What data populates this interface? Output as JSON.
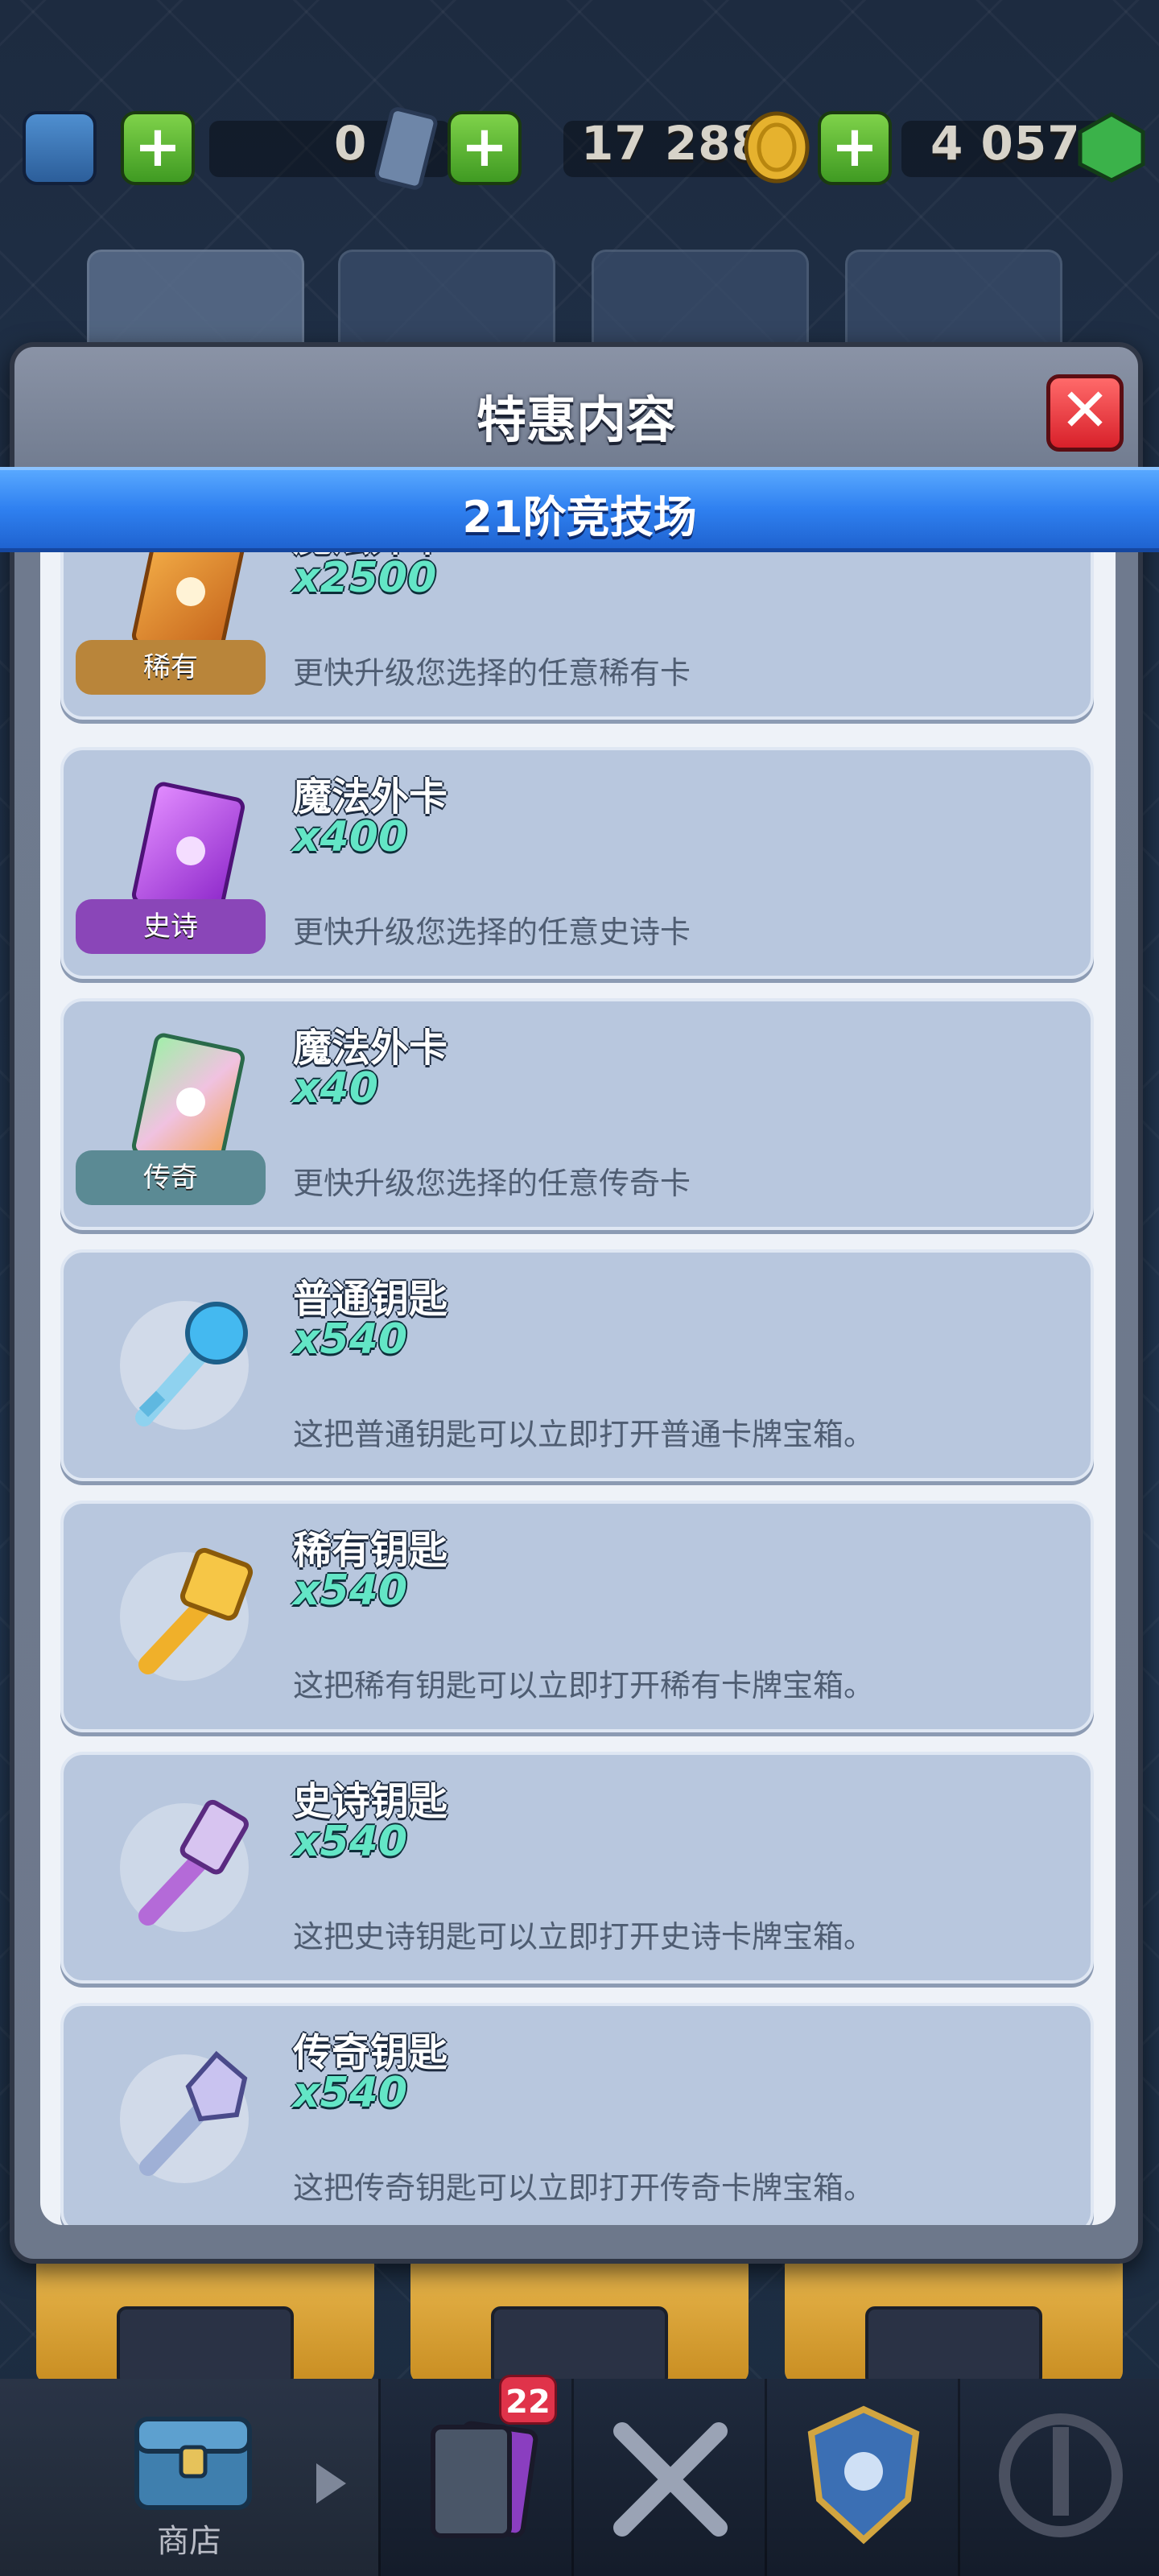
{
  "status_bar": {
    "tickets": "0",
    "gold": "17 288",
    "gems": "4 057"
  },
  "modal": {
    "title": "特惠内容",
    "close_icon": "close-icon",
    "arena_label": "21阶竞技场",
    "items": [
      {
        "name": "魔法外卡",
        "qty": "x2500",
        "desc": "更快升级您选择的任意稀有卡",
        "tag": "稀有",
        "tag_color": "#b9853a",
        "icon": "wild-card-rare-icon",
        "color": "#e38a2a"
      },
      {
        "name": "魔法外卡",
        "qty": "x400",
        "desc": "更快升级您选择的任意史诗卡",
        "tag": "史诗",
        "tag_color": "#8a46b8",
        "icon": "wild-card-epic-icon",
        "color": "#b34ee6"
      },
      {
        "name": "魔法外卡",
        "qty": "x40",
        "desc": "更快升级您选择的任意传奇卡",
        "tag": "传奇",
        "tag_color": "#5b8a94",
        "icon": "wild-card-legendary-icon",
        "color": "#6ad6a8"
      },
      {
        "name": "普通钥匙",
        "qty": "x540",
        "desc": "这把普通钥匙可以立即打开普通卡牌宝箱。",
        "icon": "common-key-icon",
        "color": "#4fc7f0"
      },
      {
        "name": "稀有钥匙",
        "qty": "x540",
        "desc": "这把稀有钥匙可以立即打开稀有卡牌宝箱。",
        "icon": "rare-key-icon",
        "color": "#f2b534"
      },
      {
        "name": "史诗钥匙",
        "qty": "x540",
        "desc": "这把史诗钥匙可以立即打开史诗卡牌宝箱。",
        "icon": "epic-key-icon",
        "color": "#c66ee0"
      },
      {
        "name": "传奇钥匙",
        "qty": "x540",
        "desc": "这把传奇钥匙可以立即打开传奇卡牌宝箱。",
        "icon": "legendary-key-icon",
        "color": "#a9b6d8"
      }
    ]
  },
  "bottom_nav": {
    "shop_label": "商店",
    "cards_badge": "22"
  }
}
